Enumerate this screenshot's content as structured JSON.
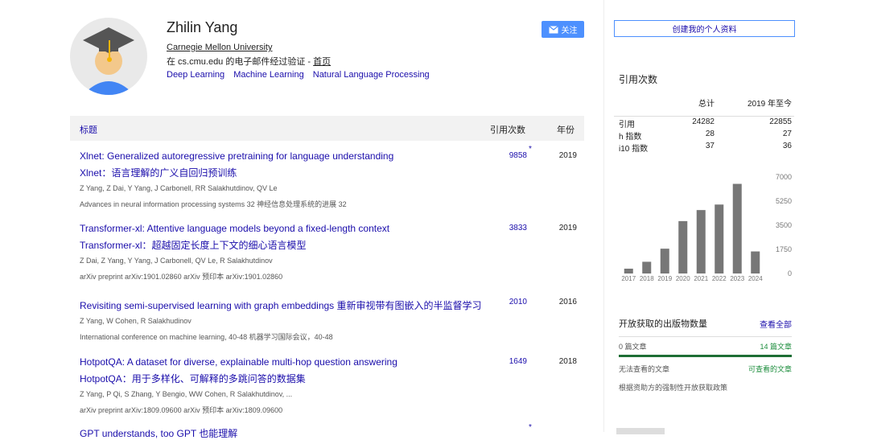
{
  "profile": {
    "name": "Zhilin Yang",
    "affiliation": "Carnegie Mellon University",
    "verified_prefix": "在 cs.cmu.edu 的电子邮件经过验证 - ",
    "homepage_label": "首页",
    "interests": [
      "Deep Learning",
      "Machine Learning",
      "Natural Language Processing"
    ]
  },
  "actions": {
    "follow_label": "关注",
    "create_profile_label": "创建我的个人资料"
  },
  "table": {
    "col_title": "标题",
    "col_cited": "引用次数",
    "col_year": "年份"
  },
  "publications": [
    {
      "title": "Xlnet: Generalized autoregressive pretraining for language understanding",
      "title_cn": "Xlnet：语言理解的广义自回归预训练",
      "authors": "Z Yang, Z Dai, Y Yang, J Carbonell, RR Salakhutdinov, QV Le",
      "venue": "Advances in neural information processing systems 32 神经信息处理系统的进展 32",
      "cited": "9858",
      "star": "*",
      "year": "2019"
    },
    {
      "title": "Transformer-xl: Attentive language models beyond a fixed-length context",
      "title_cn": "Transformer-xl：超越固定长度上下文的细心语言模型",
      "authors": "Z Dai, Z Yang, Y Yang, J Carbonell, QV Le, R Salakhutdinov",
      "venue": "arXiv preprint arXiv:1901.02860 arXiv 预印本 arXiv:1901.02860",
      "cited": "3833",
      "year": "2019"
    },
    {
      "title": "Revisiting semi-supervised learning with graph embeddings 重新审视带有图嵌入的半监督学习",
      "authors": "Z Yang, W Cohen, R Salakhudinov",
      "venue": "International conference on machine learning, 40-48 机器学习国际会议，40-48",
      "cited": "2010",
      "year": "2016"
    },
    {
      "title": "HotpotQA: A dataset for diverse, explainable multi-hop question answering",
      "title_cn": "HotpotQA：用于多样化、可解释的多跳问答的数据集",
      "authors": "Z Yang, P Qi, S Zhang, Y Bengio, WW Cohen, R Salakhutdinov, ...",
      "venue": "arXiv preprint arXiv:1809.09600 arXiv 预印本 arXiv:1809.09600",
      "cited": "1649",
      "year": "2018"
    }
  ],
  "footer_partial": {
    "title": "GPT understands, too GPT 也能理解",
    "star": "*"
  },
  "citations": {
    "title": "引用次数",
    "col_all": "总计",
    "col_since": "2019 年至今",
    "rows": [
      {
        "label": "引用",
        "all": "24282",
        "since": "22855"
      },
      {
        "label": "h 指数",
        "all": "28",
        "since": "27"
      },
      {
        "label": "i10 指数",
        "all": "37",
        "since": "36"
      }
    ]
  },
  "chart_data": {
    "type": "bar",
    "categories": [
      "2017",
      "2018",
      "2019",
      "2020",
      "2021",
      "2022",
      "2023",
      "2024"
    ],
    "values": [
      350,
      850,
      1800,
      3800,
      4600,
      5000,
      6500,
      1600
    ],
    "yticks": [
      "7000",
      "5250",
      "3500",
      "1750",
      "0"
    ],
    "ylim": [
      0,
      7000
    ],
    "bar_color": "#777777"
  },
  "open_access": {
    "title": "开放获取的出版物数量",
    "view_all": "查看全部",
    "left_count": "0 篇文章",
    "right_count": "14 篇文章",
    "left_label": "无法查看的文章",
    "right_label": "可查看的文章",
    "policy": "根据资助方的强制性开放获取政策"
  }
}
